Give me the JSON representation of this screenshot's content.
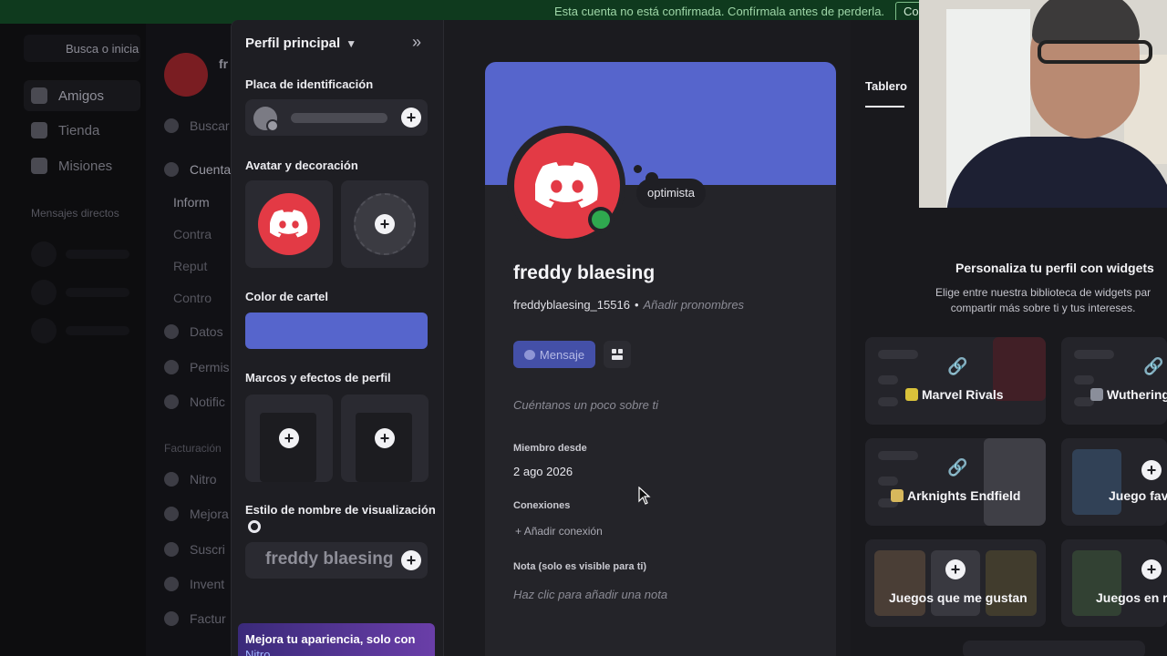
{
  "notice": {
    "text": "Esta cuenta no está confirmada. Confírmala antes de perderla.",
    "button": "Confirmar"
  },
  "bg_app": {
    "search_placeholder": "Busca o inicia u",
    "nav": [
      "Amigos",
      "Tienda",
      "Misiones"
    ],
    "dm_header": "Mensajes directos",
    "server_initial": "fr",
    "settings_items": [
      "Buscar",
      "Cuenta",
      "Inform",
      "Contra",
      "Reput",
      "Contro",
      "Datos",
      "Permis",
      "Notific"
    ],
    "billing_header": "Facturación",
    "billing_items": [
      "Nitro",
      "Mejora",
      "Suscri",
      "Invent",
      "Factur"
    ]
  },
  "editor": {
    "title": "Perfil principal",
    "sections": {
      "badge": "Placa de identificación",
      "avatar": "Avatar y decoración",
      "banner_color": "Color de cartel",
      "frames": "Marcos y efectos de perfil",
      "name_style": "Estilo de nombre de visualización"
    },
    "name_style_preview": "freddy blaesing",
    "banner_color": "#5665cc",
    "promo": {
      "text": "Mejora tu apariencia, solo con",
      "link": "Nitro"
    }
  },
  "profile": {
    "status_bubble": "optimista",
    "display_name": "freddy blaesing",
    "username": "freddyblaesing_15516",
    "pronouns_placeholder": "Añadir pronombres",
    "message_button": "Mensaje",
    "bio_placeholder": "Cuéntanos un poco sobre ti",
    "member_since_label": "Miembro desde",
    "member_since": "2 ago 2026",
    "connections_label": "Conexiones",
    "add_connection": "Añadir conexión",
    "note_label": "Nota (solo es visible para ti)",
    "note_placeholder": "Haz clic para añadir una nota",
    "online_color": "#2fa84f",
    "avatar_color": "#e33a45"
  },
  "widgets": {
    "tab": "Tablero",
    "title": "Personaliza tu perfil con widgets",
    "subtitle_line1": "Elige entre nuestra biblioteca de widgets par",
    "subtitle_line2": "compartir más sobre ti y tus intereses.",
    "items": [
      "Marvel Rivals",
      "Wuthering",
      "Arknights Endfield",
      "Juego fav",
      "Juegos que me gustan",
      "Juegos en re"
    ]
  }
}
